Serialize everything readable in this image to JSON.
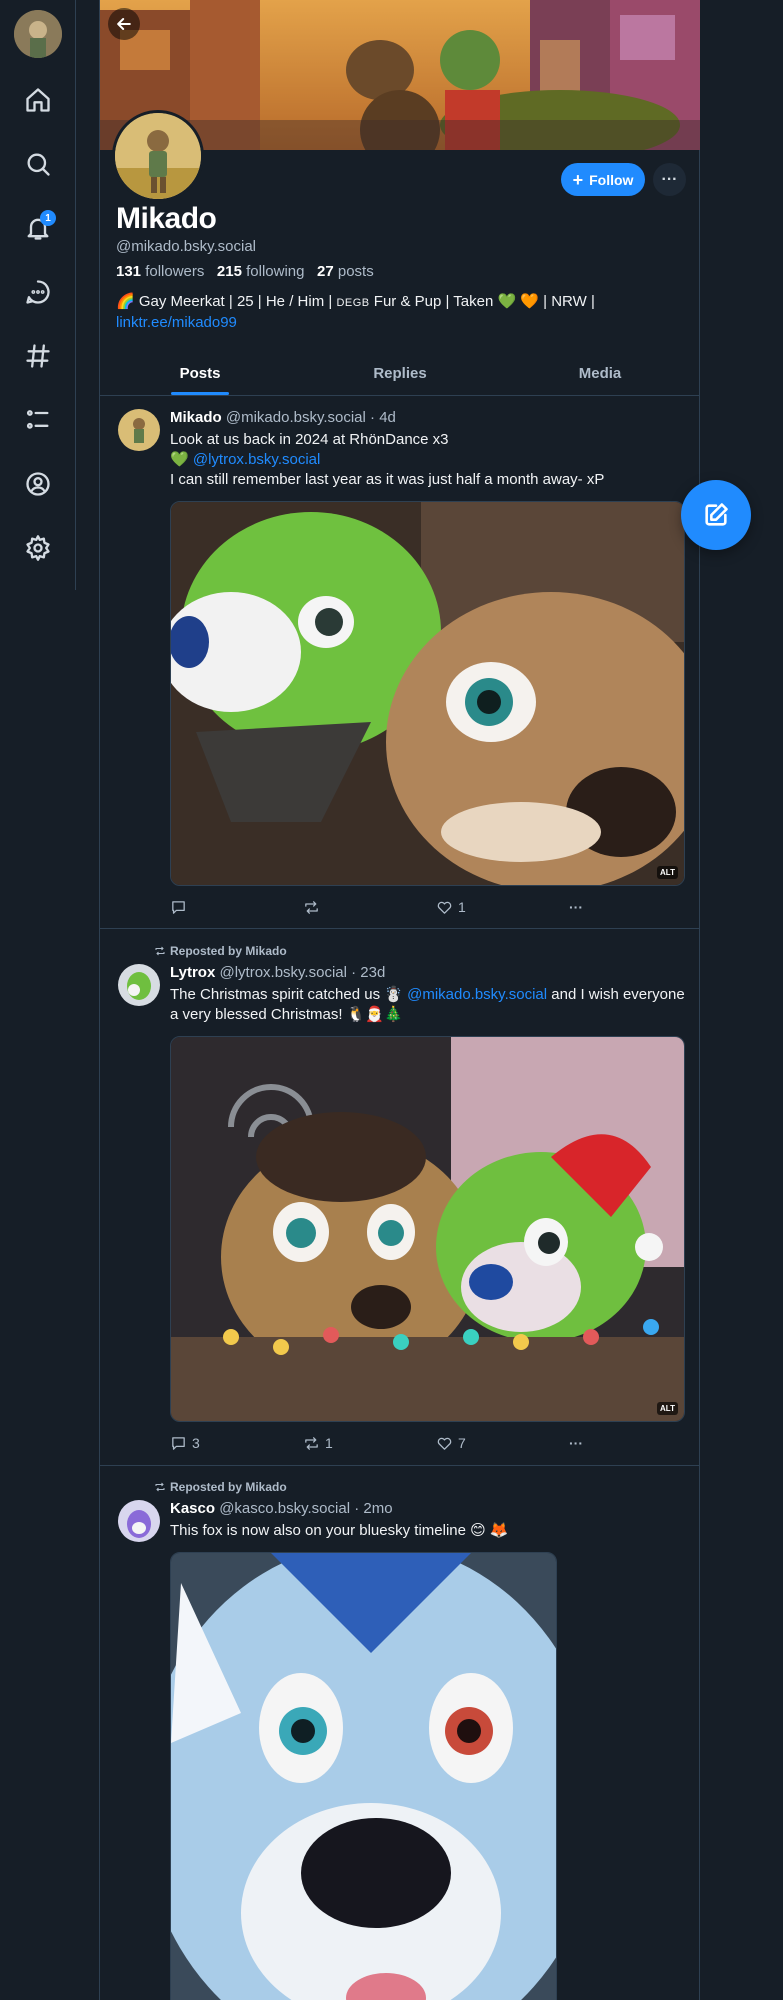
{
  "nav": {
    "items": [
      {
        "name": "home-icon"
      },
      {
        "name": "search-icon"
      },
      {
        "name": "notifications-icon",
        "badge": "1"
      },
      {
        "name": "chat-icon"
      },
      {
        "name": "hashtag-icon"
      },
      {
        "name": "lists-icon"
      },
      {
        "name": "profile-icon"
      },
      {
        "name": "settings-icon"
      }
    ]
  },
  "profile": {
    "display_name": "Mikado",
    "handle": "@mikado.bsky.social",
    "followers_count": "131",
    "followers_label": "followers",
    "following_count": "215",
    "following_label": "following",
    "posts_count": "27",
    "posts_label": "posts",
    "bio_part1": "🌈 Gay Meerkat | 25 | He / Him | ",
    "bio_region": "DEGB",
    "bio_part2": " Fur & Pup | Taken 💚 🧡 | NRW |",
    "bio_link": "linktr.ee/mikado99",
    "follow_label": "Follow"
  },
  "tabs": [
    {
      "label": "Posts",
      "active": true
    },
    {
      "label": "Replies",
      "active": false
    },
    {
      "label": "Media",
      "active": false
    }
  ],
  "posts": [
    {
      "author": "Mikado",
      "handle": "@mikado.bsky.social",
      "time": "· 4d",
      "text_line1": "Look at us back in 2024 at RhönDance x3",
      "text_heart": "💚 ",
      "text_mention": "@lytrox.bsky.social",
      "text_line3": "I can still remember last year as it was just half a month away- xP",
      "alt": "ALT",
      "replies": "",
      "reposts": "",
      "likes": "1"
    },
    {
      "repost_label": "Reposted by Mikado",
      "author": "Lytrox",
      "handle": "@lytrox.bsky.social",
      "time": "· 23d",
      "text_before": "The Christmas spirit catched us ☃️ ",
      "text_mention": "@mikado.bsky.social",
      "text_after": " and I wish everyone a very blessed Christmas! 🐧🎅🎄",
      "alt": "ALT",
      "replies": "3",
      "reposts": "1",
      "likes": "7"
    },
    {
      "repost_label": "Reposted by Mikado",
      "author": "Kasco",
      "handle": "@kasco.bsky.social",
      "time": "· 2mo",
      "text": "This fox is now also on your bluesky timeline 😊 🦊"
    }
  ],
  "colors": {
    "background": "#161e27",
    "accent": "#208bfe",
    "border": "#2e4052",
    "muted_text": "#aebbc9"
  }
}
